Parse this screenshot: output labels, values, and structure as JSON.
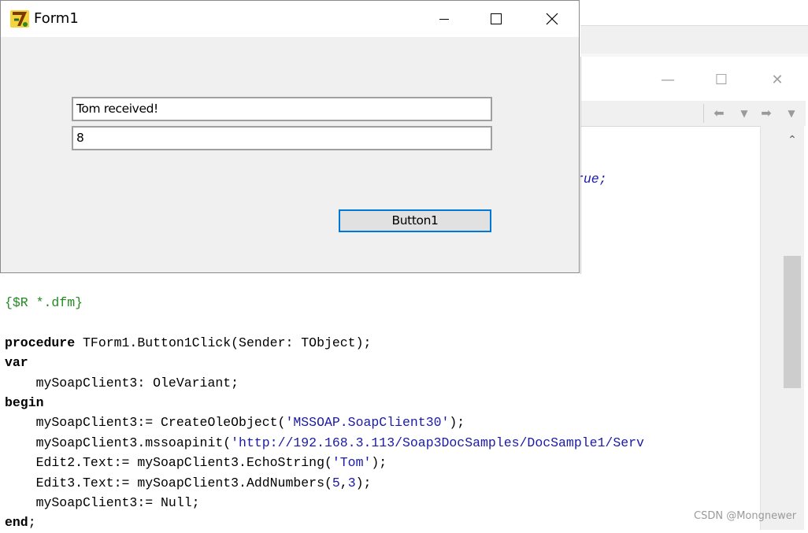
{
  "form": {
    "title": "Form1",
    "edit_top_value": "Tom received!",
    "edit_bottom_value": "8",
    "button_label": "Button1"
  },
  "editor": {
    "top_fragment": "rue;",
    "code_lines": [
      {
        "parts": [
          {
            "t": "{$R *.dfm}",
            "c": "cm"
          }
        ]
      },
      {
        "parts": [
          {
            "t": "",
            "c": ""
          }
        ]
      },
      {
        "parts": [
          {
            "t": "procedure",
            "c": "kw"
          },
          {
            "t": " TForm1.Button1Click(Sender: TObject);",
            "c": ""
          }
        ]
      },
      {
        "parts": [
          {
            "t": "var",
            "c": "kw"
          }
        ]
      },
      {
        "parts": [
          {
            "t": "    mySoapClient3: OleVariant;",
            "c": ""
          }
        ]
      },
      {
        "parts": [
          {
            "t": "begin",
            "c": "kw"
          }
        ]
      },
      {
        "parts": [
          {
            "t": "    mySoapClient3:= CreateOleObject(",
            "c": ""
          },
          {
            "t": "'MSSOAP.SoapClient30'",
            "c": "str"
          },
          {
            "t": ");",
            "c": ""
          }
        ]
      },
      {
        "parts": [
          {
            "t": "    mySoapClient3.mssoapinit(",
            "c": ""
          },
          {
            "t": "'http://192.168.3.113/Soap3DocSamples/DocSample1/Serv",
            "c": "str"
          }
        ]
      },
      {
        "parts": [
          {
            "t": "    Edit2.Text:= mySoapClient3.EchoString(",
            "c": ""
          },
          {
            "t": "'Tom'",
            "c": "str"
          },
          {
            "t": ");",
            "c": ""
          }
        ]
      },
      {
        "parts": [
          {
            "t": "    Edit3.Text:= mySoapClient3.AddNumbers(",
            "c": ""
          },
          {
            "t": "5",
            "c": "num"
          },
          {
            "t": ",",
            "c": ""
          },
          {
            "t": "3",
            "c": "num"
          },
          {
            "t": ");",
            "c": ""
          }
        ]
      },
      {
        "parts": [
          {
            "t": "    mySoapClient3:= Null;",
            "c": ""
          }
        ]
      },
      {
        "parts": [
          {
            "t": "end",
            "c": "kw"
          },
          {
            "t": ";",
            "c": ""
          }
        ]
      }
    ]
  },
  "watermark": "CSDN @Mongnewer",
  "colors": {
    "focus_border": "#0078d7",
    "comment": "#228b22",
    "string": "#1a1aa6"
  },
  "icons": {
    "app": "delphi-app-icon",
    "minimize": "minimize-icon",
    "maximize": "maximize-icon",
    "close": "close-icon"
  }
}
